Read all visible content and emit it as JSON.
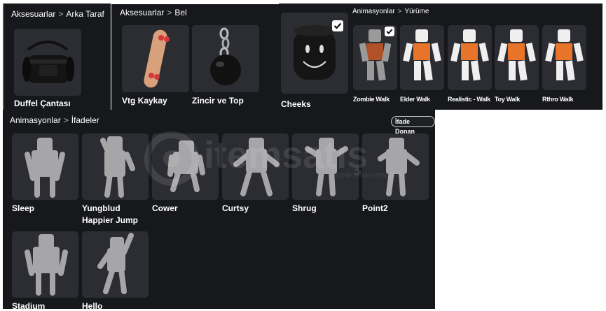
{
  "panels": {
    "arka_taraf": {
      "category": "Aksesuarlar",
      "sub": "Arka Taraf",
      "items": [
        {
          "name": "Duffel Çantası"
        }
      ]
    },
    "bel": {
      "category": "Aksesuarlar",
      "sub": "Bel",
      "items": [
        {
          "name": "Vtg Kaykay"
        },
        {
          "name": "Zincir ve Top"
        }
      ]
    },
    "face": {
      "items": [
        {
          "name": "Cheeks",
          "equipped": true
        }
      ]
    },
    "walk": {
      "category": "Animasyonlar",
      "sub": "Yürüme",
      "items": [
        {
          "name": "Zombie Walk",
          "equipped": true
        },
        {
          "name": "Elder Walk"
        },
        {
          "name": "Realistic - Walk"
        },
        {
          "name": "Toy Walk"
        },
        {
          "name": "Rthro Walk"
        }
      ]
    },
    "emotes": {
      "category": "Animasyonlar",
      "sub": "İfadeler",
      "button": "İfade Donan",
      "items": [
        {
          "line1": "Sleep",
          "line2": ""
        },
        {
          "line1": "Yungblud",
          "line2": "Happier Jump"
        },
        {
          "line1": "Cower",
          "line2": ""
        },
        {
          "line1": "Curtsy",
          "line2": ""
        },
        {
          "line1": "Shrug",
          "line2": ""
        },
        {
          "line1": "Point2",
          "line2": ""
        },
        {
          "line1": "Stadium",
          "line2": ""
        },
        {
          "line1": "Hello",
          "line2": ""
        }
      ]
    }
  },
  "watermark": {
    "text": "itemsatış",
    "tagline": "HESAP | SKIN | ITEM | E-PIN"
  },
  "colors": {
    "panel_bg": "#17181c",
    "tile_bg": "#2c2d33",
    "accent_orange": "#e8742a",
    "silhouette": "#a6a6a8"
  }
}
